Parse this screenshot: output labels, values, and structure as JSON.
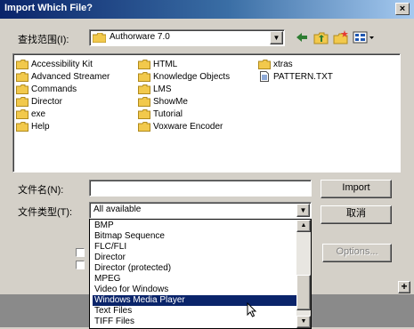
{
  "window": {
    "title": "Import Which File?",
    "close_glyph": "×"
  },
  "look_in": {
    "label": "查找范围(I):",
    "value": "Authorware 7.0"
  },
  "toolbar": {
    "icons": [
      "back-arrow-icon",
      "up-one-level-icon",
      "new-folder-icon",
      "view-menu-icon"
    ]
  },
  "file_list": {
    "items": [
      {
        "name": "Accessibility Kit",
        "type": "folder"
      },
      {
        "name": "Advanced Streamer",
        "type": "folder"
      },
      {
        "name": "Commands",
        "type": "folder"
      },
      {
        "name": "Director",
        "type": "folder"
      },
      {
        "name": "exe",
        "type": "folder"
      },
      {
        "name": "Help",
        "type": "folder"
      },
      {
        "name": "HTML",
        "type": "folder"
      },
      {
        "name": "Knowledge Objects",
        "type": "folder"
      },
      {
        "name": "LMS",
        "type": "folder"
      },
      {
        "name": "ShowMe",
        "type": "folder"
      },
      {
        "name": "Tutorial",
        "type": "folder"
      },
      {
        "name": "Voxware Encoder",
        "type": "folder"
      },
      {
        "name": "xtras",
        "type": "folder"
      },
      {
        "name": "PATTERN.TXT",
        "type": "file"
      }
    ]
  },
  "file_name": {
    "label": "文件名(N):",
    "value": ""
  },
  "file_type": {
    "label": "文件类型(T):",
    "value": "All available",
    "options": [
      "BMP",
      "Bitmap Sequence",
      "FLC/FLI",
      "Director",
      "Director (protected)",
      "MPEG",
      "Video for Windows",
      "Windows Media Player",
      "Text Files",
      "TIFF Files"
    ],
    "highlighted_index": 7
  },
  "buttons": {
    "import": "Import",
    "cancel": "取消",
    "options": "Options...",
    "expand": "+"
  },
  "colors": {
    "titlebar_start": "#0a246a",
    "titlebar_end": "#a6caf0",
    "highlight": "#0a246a",
    "folder": "#f2c94c"
  }
}
